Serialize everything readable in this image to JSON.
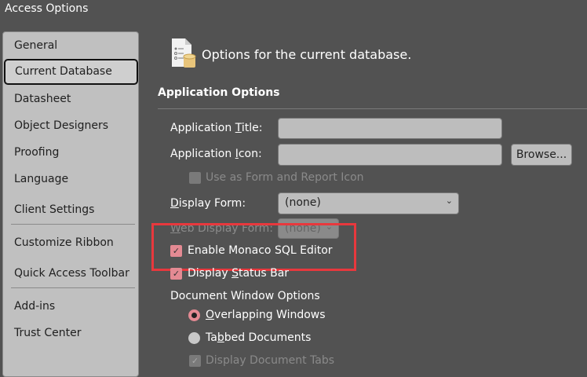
{
  "window_title": "Access Options",
  "sidebar": {
    "items": [
      "General",
      "Current Database",
      "Datasheet",
      "Object Designers",
      "Proofing",
      "Language",
      "Client Settings",
      "Customize Ribbon",
      "Quick Access Toolbar",
      "Add-ins",
      "Trust Center"
    ],
    "selected": "Current Database"
  },
  "header": {
    "title": "Options for the current database."
  },
  "section": {
    "title": "Application Options"
  },
  "fields": {
    "app_title": {
      "pre": "Application ",
      "u": "T",
      "post": "itle:",
      "value": ""
    },
    "app_icon": {
      "pre": "Application ",
      "u": "I",
      "post": "con:",
      "value": ""
    },
    "browse_label": "Browse...",
    "use_as_icon": {
      "label": "Use as Form and Report Icon",
      "checked": false,
      "disabled": true
    },
    "display_form": {
      "pre": "",
      "u": "D",
      "post": "isplay Form:",
      "value": "(none)"
    },
    "web_display_form": {
      "pre": "",
      "u": "W",
      "post": "eb Display Form:",
      "value": "(none)",
      "disabled": true
    },
    "monaco": {
      "label": "Enable Monaco SQL Editor",
      "checked": true
    },
    "status_bar": {
      "pre": "Display ",
      "u": "S",
      "post": "tatus Bar",
      "checked": true
    },
    "doc_window_options": "Document Window Options",
    "overlapping": {
      "pre": "",
      "u": "O",
      "post": "verlapping Windows",
      "selected": true
    },
    "tabbed": {
      "pre": "Ta",
      "u": "b",
      "post": "bed Documents",
      "selected": false
    },
    "display_tabs": {
      "label": "Display Document Tabs",
      "checked": true,
      "disabled": true
    }
  },
  "colors": {
    "accent": "#e48a93",
    "highlight": "#e8383d"
  }
}
